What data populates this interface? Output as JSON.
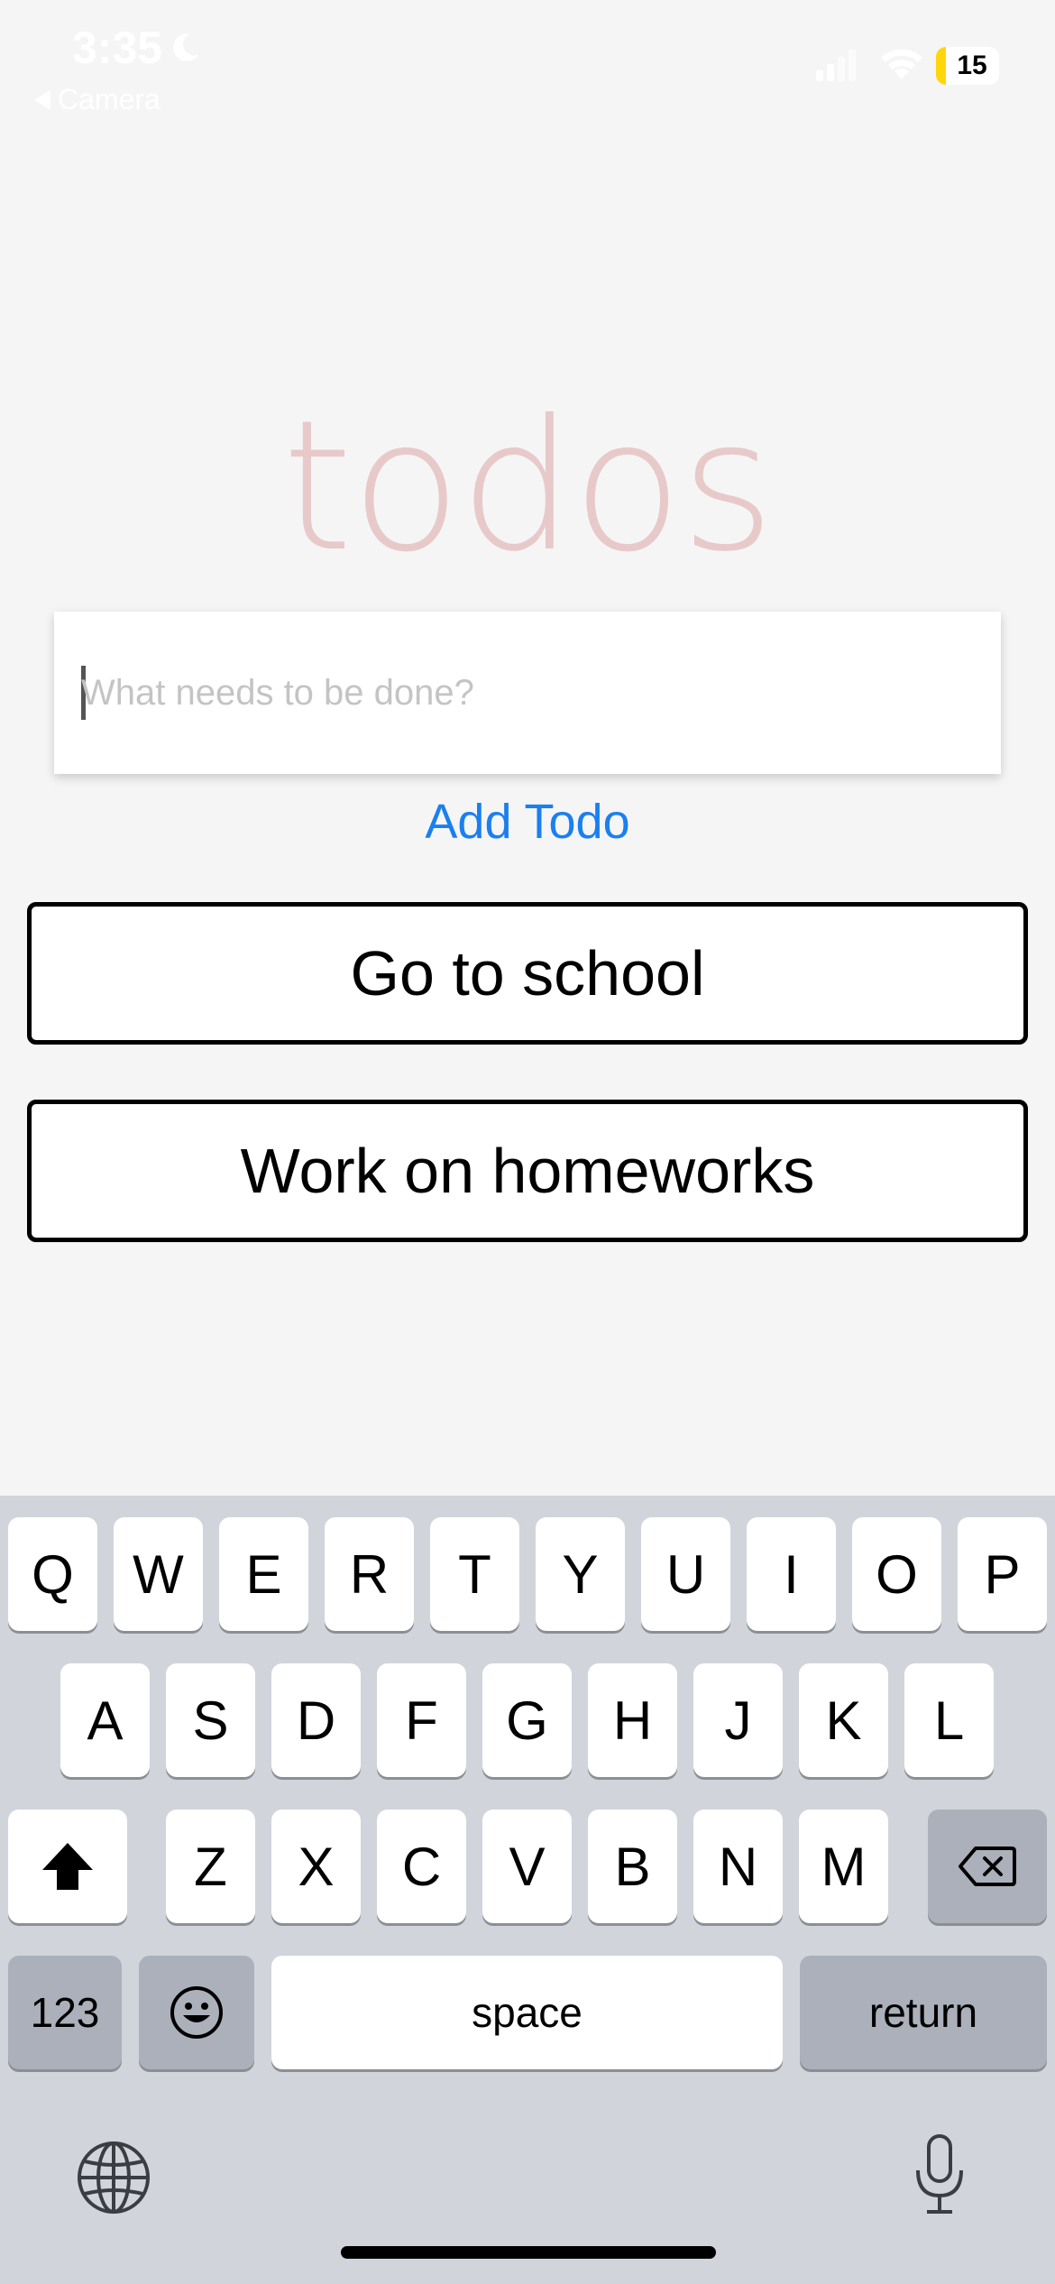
{
  "status_bar": {
    "time": "3:35",
    "back_label": "Camera",
    "battery_level": "15",
    "battery_fraction": 0.15
  },
  "app": {
    "title": "todos",
    "input_placeholder": "What needs to be done?",
    "input_value": "",
    "add_button_label": "Add Todo",
    "todos": [
      {
        "label": "Go to school"
      },
      {
        "label": "Work on homeworks"
      }
    ]
  },
  "keyboard": {
    "row1": [
      "Q",
      "W",
      "E",
      "R",
      "T",
      "Y",
      "U",
      "I",
      "O",
      "P"
    ],
    "row2": [
      "A",
      "S",
      "D",
      "F",
      "G",
      "H",
      "J",
      "K",
      "L"
    ],
    "row3": [
      "Z",
      "X",
      "C",
      "V",
      "B",
      "N",
      "M"
    ],
    "numbers_label": "123",
    "space_label": "space",
    "return_label": "return"
  },
  "colors": {
    "title": "#e8c9c9",
    "accent": "#1a7ff0",
    "keyboard_bg": "#d1d4db"
  }
}
